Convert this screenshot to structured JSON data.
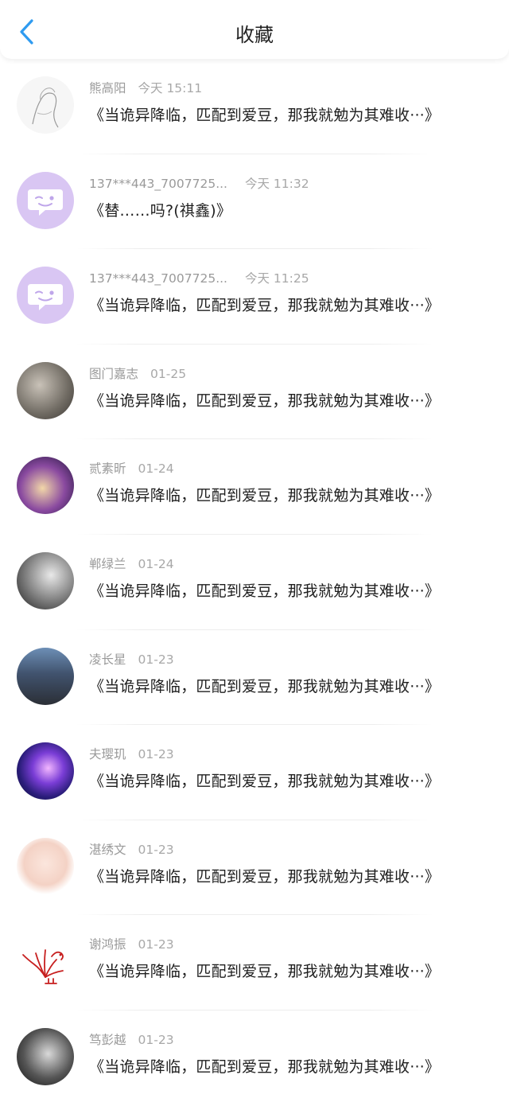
{
  "header": {
    "title": "收藏",
    "back_icon": "chevron-left-icon",
    "accent": "#2f9bf0"
  },
  "items": [
    {
      "name": "熊高阳",
      "time": "今天 15:11",
      "text": "《当诡异降临，匹配到爱豆，那我就勉为其难收···》",
      "avatar": "sketch"
    },
    {
      "name": "137***443_7007725...",
      "time": "今天 11:32",
      "text": "《替……吗?(祺鑫)》",
      "avatar": "bubble"
    },
    {
      "name": "137***443_7007725...",
      "time": "今天 11:25",
      "text": "《当诡异降临，匹配到爱豆，那我就勉为其难收···》",
      "avatar": "bubble"
    },
    {
      "name": "图门嘉志",
      "time": "01-25",
      "text": "《当诡异降临，匹配到爱豆，那我就勉为其难收···》",
      "avatar": "photo"
    },
    {
      "name": "贰素昕",
      "time": "01-24",
      "text": "《当诡异降临，匹配到爱豆，那我就勉为其难收···》",
      "avatar": "photo"
    },
    {
      "name": "郸绿兰",
      "time": "01-24",
      "text": "《当诡异降临，匹配到爱豆，那我就勉为其难收···》",
      "avatar": "photo"
    },
    {
      "name": "凌长星",
      "time": "01-23",
      "text": "《当诡异降临，匹配到爱豆，那我就勉为其难收···》",
      "avatar": "photo"
    },
    {
      "name": "夫璎玑",
      "time": "01-23",
      "text": "《当诡异降临，匹配到爱豆，那我就勉为其难收···》",
      "avatar": "galaxy"
    },
    {
      "name": "湛绣文",
      "time": "01-23",
      "text": "《当诡异降临，匹配到爱豆，那我就勉为其难收···》",
      "avatar": "photo"
    },
    {
      "name": "谢鸿振",
      "time": "01-23",
      "text": "《当诡异降临，匹配到爱豆，那我就勉为其难收···》",
      "avatar": "rooster"
    },
    {
      "name": "笃彭越",
      "time": "01-23",
      "text": "《当诡异降临，匹配到爱豆，那我就勉为其难收···》",
      "avatar": "photo"
    }
  ]
}
